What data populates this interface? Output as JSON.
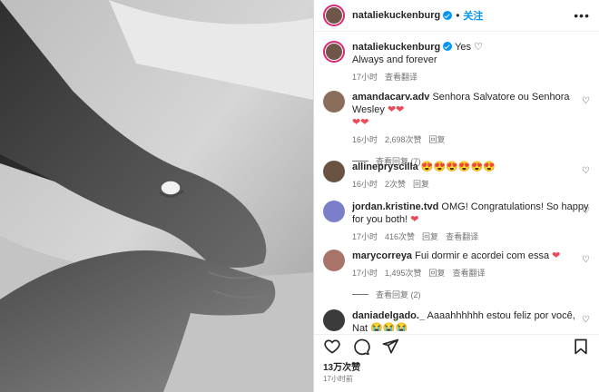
{
  "post": {
    "username": "nataliekuckenburg",
    "follow_label": "关注",
    "more_label": "•••"
  },
  "caption": {
    "username": "nataliekuckenburg",
    "text_inline": "Yes",
    "text_line2": "Always and forever",
    "time": "17小时",
    "translate_label": "查看翻译"
  },
  "comments": [
    {
      "username": "amandacarv.adv",
      "text": "Senhora Salvatore ou Senhora Wesley",
      "time": "16小时",
      "likes": "2,698次赞",
      "reply": "回复",
      "replies": "查看回复 (7)",
      "avatar_color": "#8a6d5a"
    },
    {
      "username": "allinepryscilla",
      "text": "",
      "time": "16小时",
      "likes": "2次赞",
      "reply": "回复",
      "avatar_color": "#6b5344"
    },
    {
      "username": "jordan.kristine.tvd",
      "text": "OMG! Congratulations! So happy for you both!",
      "time": "17小时",
      "likes": "416次赞",
      "reply": "回复",
      "translate": "查看翻译",
      "avatar_color": "#7b7fc9"
    },
    {
      "username": "marycorreya",
      "text": "Fui dormir e acordei com essa",
      "time": "17小时",
      "likes": "1,495次赞",
      "reply": "回复",
      "translate": "查看翻译",
      "replies": "查看回复 (2)",
      "avatar_color": "#a8746a"
    },
    {
      "username": "daniadelgado._",
      "text": "Aaaahhhhhh estou feliz por você, Nat",
      "avatar_color": "#3b3b3b"
    }
  ],
  "footer": {
    "likes": "13万次赞",
    "time": "17小时前"
  },
  "icons": [
    "heart-icon",
    "comment-icon",
    "share-icon",
    "bookmark-icon",
    "verified-icon"
  ],
  "colors": {
    "accent": "#0095f6",
    "heart": "#ed4956",
    "muted": "#737373"
  }
}
